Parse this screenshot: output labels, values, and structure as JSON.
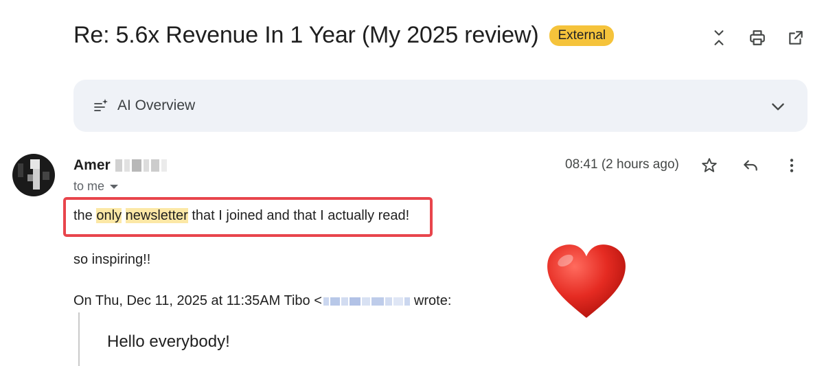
{
  "email": {
    "subject": "Re: 5.6x Revenue In 1 Year (My 2025 review)",
    "label": "External",
    "label_color": "#f5c33b"
  },
  "top_actions": {
    "icons": [
      "collapse-icon",
      "print-icon",
      "open-new-window-icon"
    ]
  },
  "ai_overview": {
    "label": "AI Overview"
  },
  "message": {
    "sender_name_visible": "Amer",
    "recipient": "to me",
    "timestamp": "08:41 (2 hours ago)",
    "body_line1": {
      "w1": "the",
      "hl1": "only",
      "hl2": "newsletter",
      "rest": "that I joined and that I actually read!"
    },
    "body_line2": "so inspiring!!",
    "quote_header_prefix": "On Thu, Dec 11, 2025 at 11:35AM Tibo <",
    "quote_header_suffix": "wrote:",
    "quoted_text": "Hello everybody!"
  },
  "colors": {
    "highlight_box": "#e8454c",
    "search_highlight": "#fce8a6",
    "ai_overview_bg": "#eff2f7"
  }
}
